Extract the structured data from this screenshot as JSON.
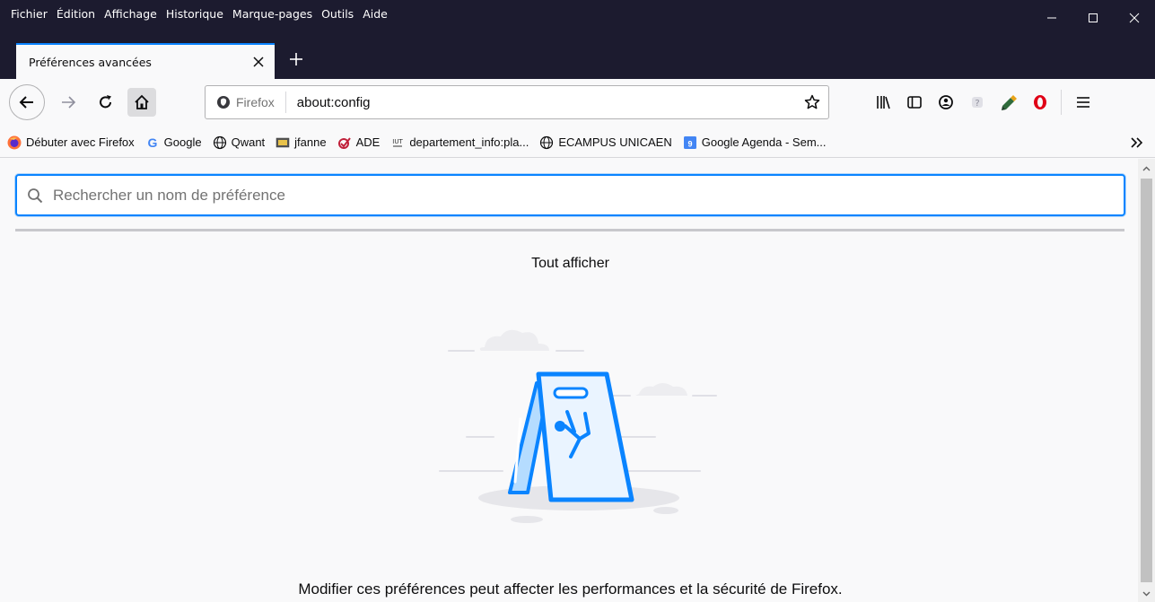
{
  "menubar": {
    "items": [
      {
        "label": "Fichier"
      },
      {
        "label": "Édition"
      },
      {
        "label": "Affichage"
      },
      {
        "label": "Historique"
      },
      {
        "label": "Marque-pages"
      },
      {
        "label": "Outils"
      },
      {
        "label": "Aide"
      }
    ]
  },
  "window_controls": {
    "minimize": "—",
    "maximize": "☐",
    "close": "✕"
  },
  "tab": {
    "title": "Préférences avancées",
    "close": "✕"
  },
  "new_tab": "+",
  "urlbar": {
    "identity_label": "Firefox",
    "url": "about:config"
  },
  "bookmarks": [
    {
      "label": "Débuter avec Firefox",
      "icon": "firefox-icon"
    },
    {
      "label": "Google",
      "icon": "google-icon"
    },
    {
      "label": "Qwant",
      "icon": "globe-icon"
    },
    {
      "label": "jfanne",
      "icon": "image-icon"
    },
    {
      "label": "ADE",
      "icon": "ade-icon"
    },
    {
      "label": "departement_info:pla...",
      "icon": "iut-icon"
    },
    {
      "label": "ECAMPUS UNICAEN",
      "icon": "globe-icon"
    },
    {
      "label": "Google Agenda - Sem...",
      "icon": "calendar-icon"
    }
  ],
  "bookmarks_overflow": "»",
  "search": {
    "placeholder": "Rechercher un nom de préférence",
    "value": ""
  },
  "show_all": "Tout afficher",
  "warning": "Modifier ces préférences peut affecter les performances et la sécurité de Firefox.",
  "colors": {
    "accent": "#0a84ff",
    "titlebar": "#1c1b2f",
    "illustration": "#0a84ff"
  }
}
